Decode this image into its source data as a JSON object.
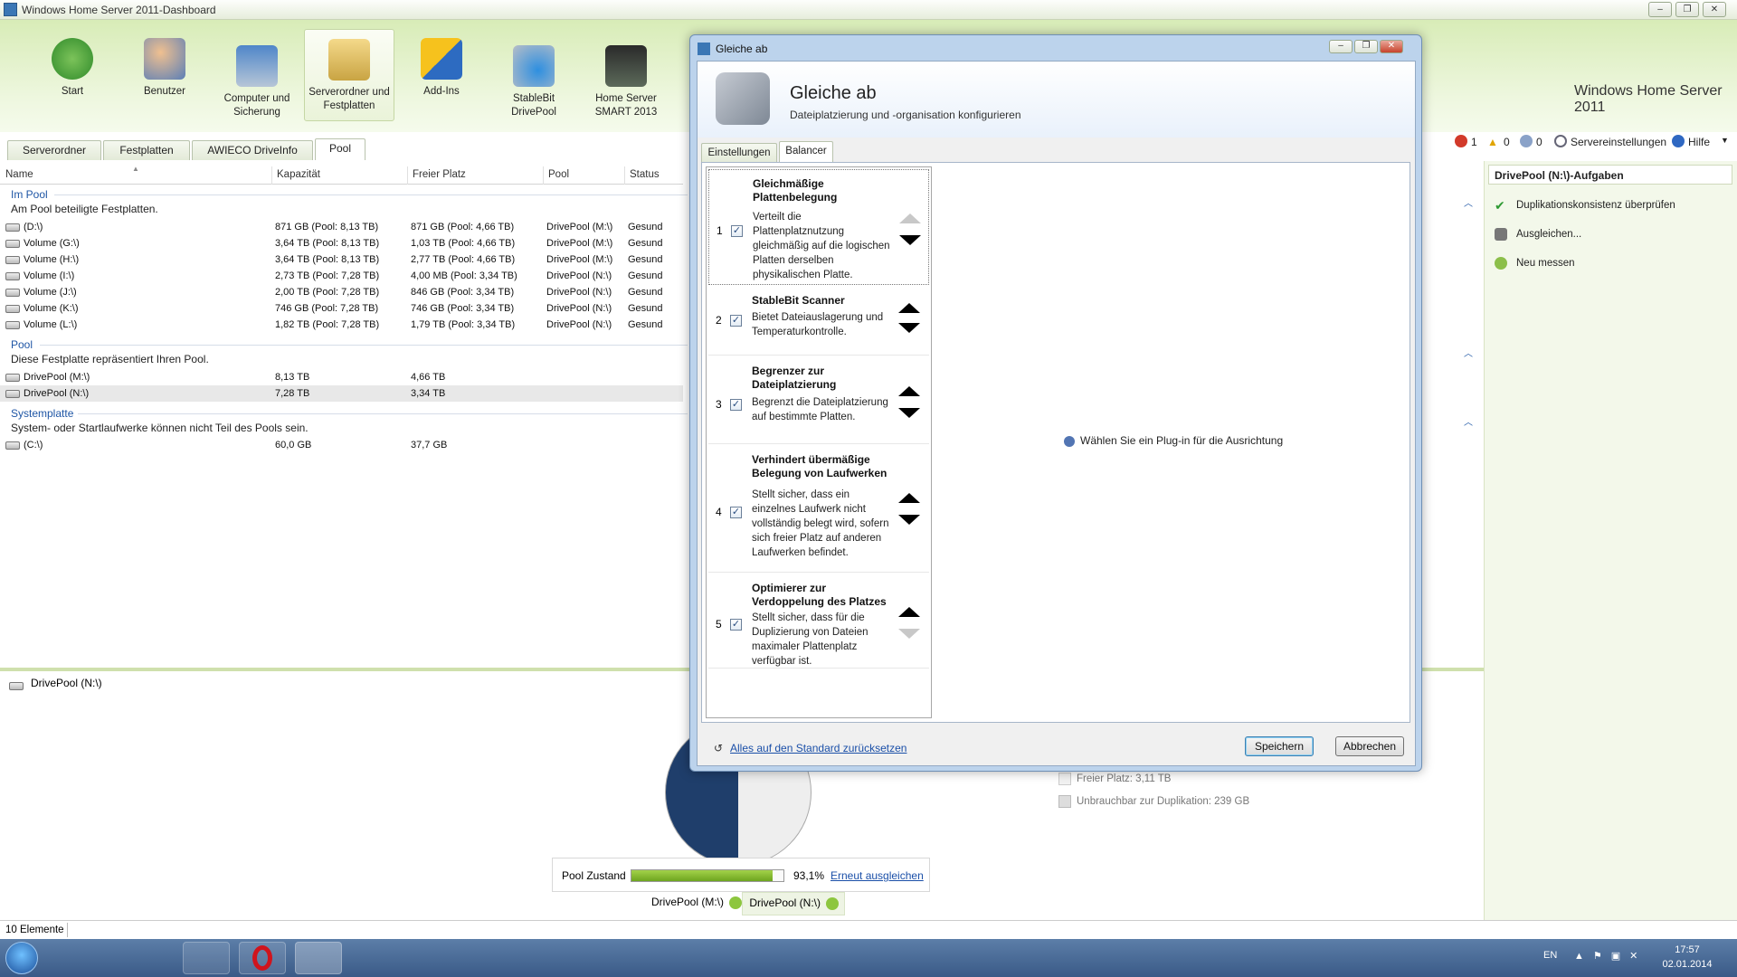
{
  "window": {
    "title": "Windows Home Server 2011-Dashboard"
  },
  "logo": "Windows Home Server 2011",
  "nav": [
    {
      "label": "Start"
    },
    {
      "label": "Benutzer"
    },
    {
      "label": "Computer und Sicherung"
    },
    {
      "label": "Serverordner und Festplatten"
    },
    {
      "label": "Add-Ins"
    },
    {
      "label": "StableBit DrivePool"
    },
    {
      "label": "Home Server SMART 2013"
    }
  ],
  "tabs": [
    "Serverordner",
    "Festplatten",
    "AWIECO DriveInfo",
    "Pool"
  ],
  "status": {
    "errors": "1",
    "warnings": "0",
    "infos": "0",
    "settings": "Servereinstellungen",
    "help": "Hilfe"
  },
  "columns": [
    "Name",
    "Kapazität",
    "Freier Platz",
    "Pool",
    "Status"
  ],
  "groups": {
    "inpool": {
      "title": "Im Pool",
      "desc": "Am Pool beteiligte Festplatten."
    },
    "pool": {
      "title": "Pool",
      "desc": "Diese Festplatte repräsentiert Ihren Pool."
    },
    "system": {
      "title": "Systemplatte",
      "desc": "System- oder Startlaufwerke können nicht Teil des Pools sein."
    }
  },
  "inpool_rows": [
    {
      "name": "(D:\\)",
      "cap": "871 GB (Pool: 8,13 TB)",
      "free": "871 GB (Pool: 4,66 TB)",
      "pool": "DrivePool (M:\\)",
      "status": "Gesund"
    },
    {
      "name": "Volume (G:\\)",
      "cap": "3,64 TB (Pool: 8,13 TB)",
      "free": "1,03 TB (Pool: 4,66 TB)",
      "pool": "DrivePool (M:\\)",
      "status": "Gesund"
    },
    {
      "name": "Volume (H:\\)",
      "cap": "3,64 TB (Pool: 8,13 TB)",
      "free": "2,77 TB (Pool: 4,66 TB)",
      "pool": "DrivePool (M:\\)",
      "status": "Gesund"
    },
    {
      "name": "Volume (I:\\)",
      "cap": "2,73 TB (Pool: 7,28 TB)",
      "free": "4,00 MB (Pool: 3,34 TB)",
      "pool": "DrivePool (N:\\)",
      "status": "Gesund"
    },
    {
      "name": "Volume (J:\\)",
      "cap": "2,00 TB (Pool: 7,28 TB)",
      "free": "846 GB (Pool: 3,34 TB)",
      "pool": "DrivePool (N:\\)",
      "status": "Gesund"
    },
    {
      "name": "Volume (K:\\)",
      "cap": "746 GB (Pool: 7,28 TB)",
      "free": "746 GB (Pool: 3,34 TB)",
      "pool": "DrivePool (N:\\)",
      "status": "Gesund"
    },
    {
      "name": "Volume (L:\\)",
      "cap": "1,82 TB (Pool: 7,28 TB)",
      "free": "1,79 TB (Pool: 3,34 TB)",
      "pool": "DrivePool (N:\\)",
      "status": "Gesund"
    }
  ],
  "pool_rows": [
    {
      "name": "DrivePool (M:\\)",
      "cap": "8,13 TB",
      "free": "4,66 TB"
    },
    {
      "name": "DrivePool (N:\\)",
      "cap": "7,28 TB",
      "free": "3,34 TB"
    }
  ],
  "system_rows": [
    {
      "name": "(C:\\)",
      "cap": "60,0 GB",
      "free": "37,7 GB"
    }
  ],
  "tasks": {
    "title": "DrivePool (N:\\)-Aufgaben",
    "items": [
      "Duplikationskonsistenz überprüfen",
      "Ausgleichen...",
      "Neu messen"
    ]
  },
  "detail": {
    "drive": "DrivePool (N:\\)",
    "legend_free": "Freier Platz: 3,11 TB",
    "legend_unusable": "Unbrauchbar zur Duplikation: 239 GB",
    "pool_state_label": "Pool Zustand",
    "pool_state_percent": "93,1%",
    "pool_state_value": 0.931,
    "rebalance_link": "Erneut ausgleichen",
    "pools": [
      "DrivePool (M:\\)",
      "DrivePool (N:\\)"
    ]
  },
  "statusbar": {
    "count": "10 Elemente"
  },
  "clock": {
    "time": "17:57",
    "date": "02.01.2014",
    "lang": "EN"
  },
  "dialog": {
    "title": "Gleiche ab",
    "heading": "Gleiche ab",
    "subheading": "Dateiplatzierung und -organisation konfigurieren",
    "tabs": [
      "Einstellungen",
      "Balancer"
    ],
    "plugins": [
      {
        "num": "1",
        "title": "Gleichmäßige Plattenbelegung",
        "desc": "Verteilt die Plattenplatznutzung gleichmäßig auf die logischen Platten derselben physikalischen Platte."
      },
      {
        "num": "2",
        "title": "StableBit Scanner",
        "desc": "Bietet Dateiauslagerung und Temperaturkontrolle."
      },
      {
        "num": "3",
        "title": "Begrenzer zur Dateiplatzierung",
        "desc": "Begrenzt die Dateiplatzierung auf bestimmte Platten."
      },
      {
        "num": "4",
        "title": "Verhindert übermäßige Belegung von Laufwerken",
        "desc": "Stellt sicher, dass ein einzelnes Laufwerk nicht vollständig belegt wird, sofern sich freier Platz auf anderen Laufwerken befindet."
      },
      {
        "num": "5",
        "title": "Optimierer zur Verdoppelung des Platzes",
        "desc": "Stellt sicher, dass für die Duplizierung von Dateien maximaler Plattenplatz verfügbar ist."
      }
    ],
    "hint": "Wählen Sie ein Plug-in für die Ausrichtung",
    "reset": "Alles auf den Standard zurücksetzen",
    "save": "Speichern",
    "cancel": "Abbrechen"
  }
}
